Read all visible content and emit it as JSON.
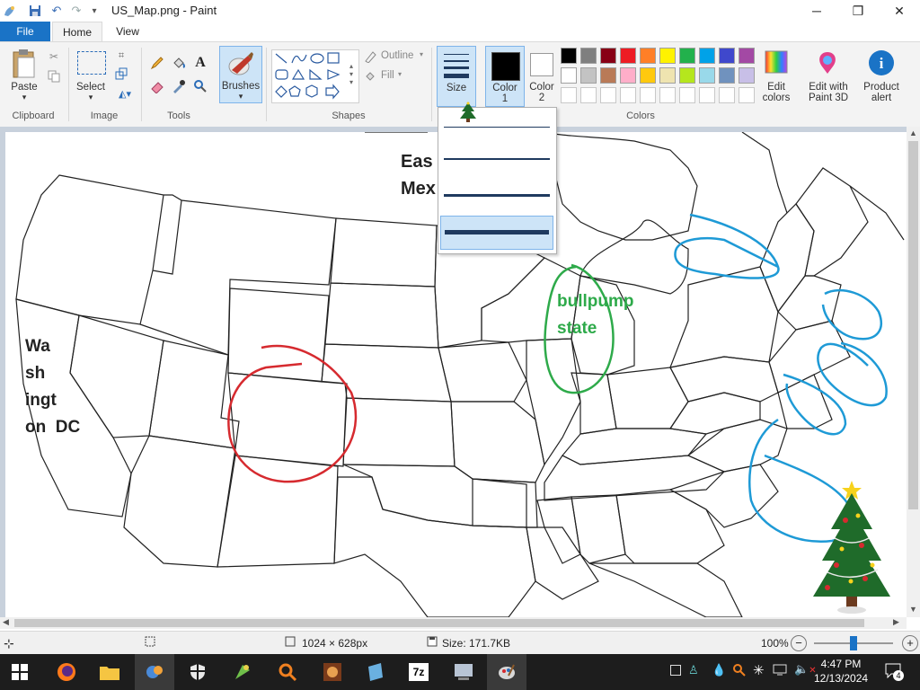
{
  "window": {
    "title": "US_Map.png - Paint",
    "minimize": "─",
    "maximize": "❐",
    "close": "✕"
  },
  "tabs": {
    "file": "File",
    "home": "Home",
    "view": "View"
  },
  "ribbon": {
    "clipboard": {
      "paste": "Paste",
      "group": "Clipboard"
    },
    "image": {
      "select": "Select",
      "group": "Image"
    },
    "tools": {
      "group": "Tools"
    },
    "brushes": {
      "label": "Brushes"
    },
    "shapes": {
      "outline": "Outline",
      "fill": "Fill",
      "group": "Shapes"
    },
    "size": {
      "label": "Size"
    },
    "color1": {
      "label": "Color",
      "num": "1"
    },
    "color2": {
      "label": "Color",
      "num": "2"
    },
    "colors": {
      "group": "Colors"
    },
    "edit_colors": {
      "line1": "Edit",
      "line2": "colors"
    },
    "paint3d": {
      "line1": "Edit with",
      "line2": "Paint 3D"
    },
    "product_alert": {
      "line1": "Product",
      "line2": "alert"
    }
  },
  "palette": {
    "row1": [
      "#000000",
      "#7f7f7f",
      "#880015",
      "#ed1c24",
      "#ff7f27",
      "#fff200",
      "#22b14c",
      "#00a2e8",
      "#3f48cc",
      "#a349a4"
    ],
    "row2": [
      "#ffffff",
      "#c3c3c3",
      "#b97a57",
      "#ffaec9",
      "#ffc90e",
      "#efe4b0",
      "#b5e61d",
      "#99d9ea",
      "#7092be",
      "#c8bfe7"
    ],
    "row3_count_note": "empty"
  },
  "canvas_text": {
    "east_mex_line1": "Eas",
    "east_mex_line2": "Mex",
    "washington_dc": [
      "Wa",
      "sh",
      "ingt",
      "on  DC"
    ],
    "bullpump_line1": "bullpump",
    "bullpump_line2": "state"
  },
  "statusbar": {
    "dimensions": "1024 × 628px",
    "size": "Size: 171.7KB",
    "zoom": "100%",
    "zoom_level_fraction": 0.5
  },
  "taskbar": {
    "time": "4:47 PM",
    "date": "12/13/2024",
    "notifications": "4"
  },
  "colors": {
    "accent": "#1a73c6",
    "red_circle": "#d62a2f",
    "green_text": "#2eaa4a",
    "blue_scribble": "#1e9ad6"
  }
}
